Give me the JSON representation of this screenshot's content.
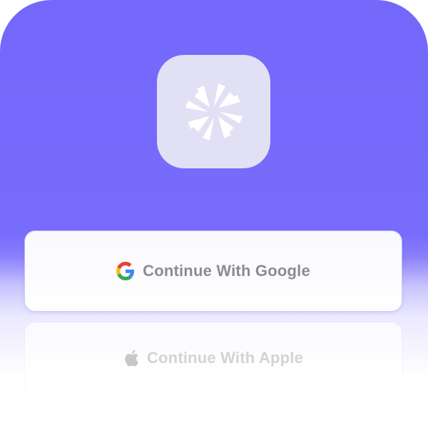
{
  "app": {
    "icon": "pinwheel-logo-icon"
  },
  "buttons": {
    "google": {
      "label": "Continue With Google",
      "icon": "google-g-icon"
    },
    "apple": {
      "label": "Continue With Apple",
      "icon": "apple-logo-icon"
    }
  },
  "colors": {
    "brand_purple": "#7468fb",
    "icon_tile": "#e2e0f5",
    "google_label": "#8c8c8f",
    "apple_label": "#d3d3d6"
  }
}
